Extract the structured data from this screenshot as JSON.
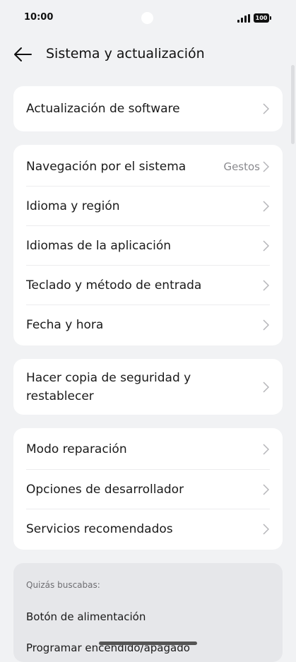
{
  "status": {
    "time": "10:00",
    "battery": "100"
  },
  "header": {
    "title": "Sistema y actualización"
  },
  "groups": [
    {
      "items": [
        {
          "label": "Actualización de software"
        }
      ]
    },
    {
      "items": [
        {
          "label": "Navegación por el sistema",
          "value": "Gestos"
        },
        {
          "label": "Idioma y región"
        },
        {
          "label": "Idiomas de la aplicación"
        },
        {
          "label": "Teclado y método de entrada"
        },
        {
          "label": "Fecha y hora"
        }
      ]
    },
    {
      "items": [
        {
          "label_line1": "Hacer copia de seguridad y",
          "label_line2": "restablecer"
        }
      ]
    },
    {
      "items": [
        {
          "label": "Modo reparación"
        },
        {
          "label": "Opciones de desarrollador"
        },
        {
          "label": "Servicios recomendados"
        }
      ]
    }
  ],
  "suggestions": {
    "heading": "Quizás buscabas:",
    "items": [
      "Botón de alimentación",
      "Programar encendido/apagado"
    ]
  },
  "icons": {
    "back": "arrow-left-icon",
    "chevron": "chevron-right-icon"
  }
}
